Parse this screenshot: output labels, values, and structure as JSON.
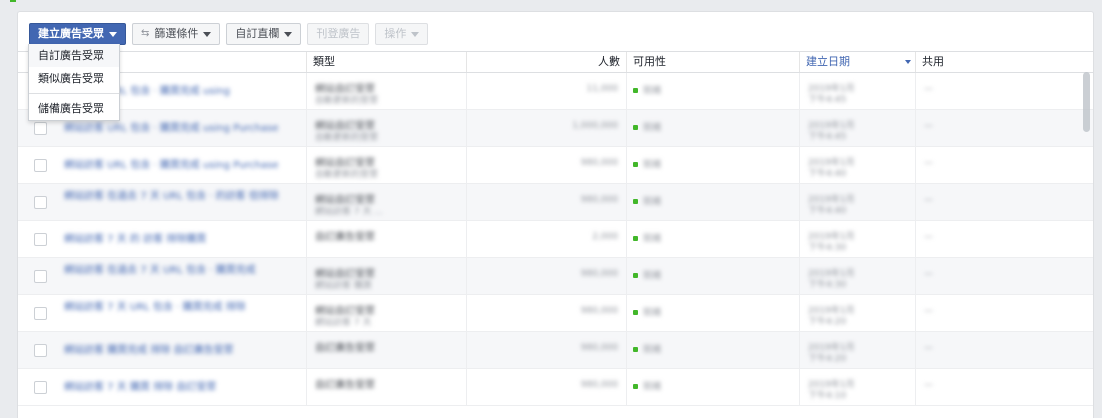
{
  "toolbar": {
    "create_audience": "建立廣告受眾",
    "filters": "篩選條件",
    "custom_columns": "自訂直欄",
    "publish_ads": "刊登廣告",
    "actions": "操作"
  },
  "dropdown": {
    "items": [
      "自訂廣告受眾",
      "類似廣告受眾",
      "儲備廣告受眾"
    ]
  },
  "columns": {
    "type": "類型",
    "size": "人數",
    "availability": "可用性",
    "date_created": "建立日期",
    "sharing": "共用"
  },
  "rows": [
    {
      "name": "網站訪客 URL 包含 · 購買完成 using",
      "type1": "網站自訂受眾",
      "type2": "自動更新的受眾",
      "size": "11,000",
      "avail": "就緒",
      "date": "2019年1月",
      "sub": "下午4:45",
      "share": "—"
    },
    {
      "name": "網站訪客 URL 包含 · 購買完成 using Purchase",
      "type1": "網站自訂受眾",
      "type2": "自動更新的受眾",
      "size": "1,000,000",
      "avail": "就緒",
      "date": "2019年1月",
      "sub": "下午4:45",
      "share": "—"
    },
    {
      "name": "網站訪客 URL 包含 · 購買完成 using Purchase",
      "type1": "網站自訂受眾",
      "type2": "自動更新的受眾",
      "size": "980,000",
      "avail": "就緒",
      "date": "2019年1月",
      "sub": "下午4:40",
      "share": "—"
    },
    {
      "name": "網站訪客 在過去 7 天 URL 包含 · 的訪客 但排除",
      "type1": "網站自訂受眾",
      "type2": "網站訪客 7 天 ...",
      "size": "980,000",
      "avail": "就緒",
      "date": "2019年1月",
      "sub": "下午4:40",
      "share": "—"
    },
    {
      "name": "網站訪客 7 天 的 訪客 排除購買",
      "type1": "自訂廣告受眾",
      "type2": "",
      "size": "2,000",
      "avail": "就緒",
      "date": "2019年1月",
      "sub": "下午4:30",
      "share": "—"
    },
    {
      "name": "網站訪客 在過去 7 天 URL 包含 · 購買完成",
      "type1": "網站自訂受眾",
      "type2": "網站訪客 購買",
      "size": "980,000",
      "avail": "就緒",
      "date": "2019年1月",
      "sub": "下午4:30",
      "share": "—"
    },
    {
      "name": "網站訪客 7 天 URL 包含 · 購買完成 排除",
      "type1": "網站自訂受眾",
      "type2": "網站訪客 7 天",
      "size": "980,000",
      "avail": "就緒",
      "date": "2019年1月",
      "sub": "下午4:20",
      "share": "—"
    },
    {
      "name": "網站訪客 購買完成 排除 自訂廣告受眾",
      "type1": "自訂廣告受眾",
      "type2": "",
      "size": "980,000",
      "avail": "就緒",
      "date": "2019年1月",
      "sub": "下午4:20",
      "share": "—"
    },
    {
      "name": "網站訪客 7 天 購買 排除 自訂受眾",
      "type1": "自訂廣告受眾",
      "type2": "",
      "size": "980,000",
      "avail": "就緒",
      "date": "2019年1月",
      "sub": "下午4:10",
      "share": "—"
    }
  ]
}
